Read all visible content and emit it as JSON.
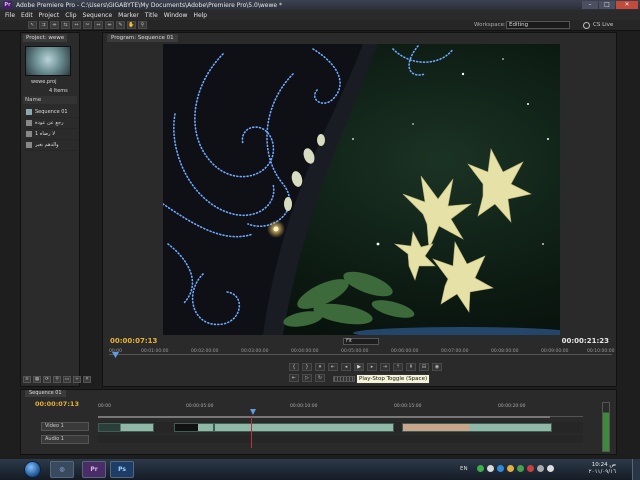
{
  "window": {
    "title": "Adobe Premiere Pro - C:\\Users\\GIGABYTE\\My Documents\\Adobe\\Premiere Pro\\5.0\\wewe *",
    "logo": "Pr",
    "minimize_icon": "minimize-icon",
    "maximize_icon": "maximize-icon",
    "close_icon": "close-icon"
  },
  "menu": [
    "File",
    "Edit",
    "Project",
    "Clip",
    "Sequence",
    "Marker",
    "Title",
    "Window",
    "Help"
  ],
  "workspace": {
    "label": "Workspace:",
    "value": "Editing",
    "cs_live": "CS Live"
  },
  "project": {
    "tab": "Project: wewe",
    "file": "wewe.proj",
    "items_count": "4 Items",
    "column_header": "Name",
    "items": [
      "Sequence 01",
      "رجع عن عودة",
      "لا رضاه 1",
      "والدهم بغير"
    ]
  },
  "program": {
    "tab": "Program: Sequence 01",
    "current_tc": "00:00:07:13",
    "duration_tc": "00:00:21:23",
    "zoom": "Fit",
    "ruler_ticks": [
      "00:00",
      "00:01:00:00",
      "00:02:00:00",
      "00:03:00:00",
      "00:04:00:00",
      "00:05:00:00",
      "00:06:00:00",
      "00:07:00:00",
      "00:08:00:00",
      "00:09:00:00",
      "00:10:00:00"
    ],
    "tooltip": "Play-Stop Toggle (Space)"
  },
  "timeline": {
    "tab": "Sequence 01",
    "current_tc": "00:00:07:13",
    "ruler_ticks": [
      "00:00",
      "00:00:05:00",
      "00:00:10:00",
      "00:00:15:00",
      "00:00:20:00"
    ],
    "video_track": "Video 1",
    "audio_track": "Audio 1"
  },
  "taskbar": {
    "apps": [
      "Pr",
      "Ps"
    ],
    "language": "EN",
    "time": "10:24 ص",
    "date": "٢٠١١/٠٩/١٦"
  }
}
